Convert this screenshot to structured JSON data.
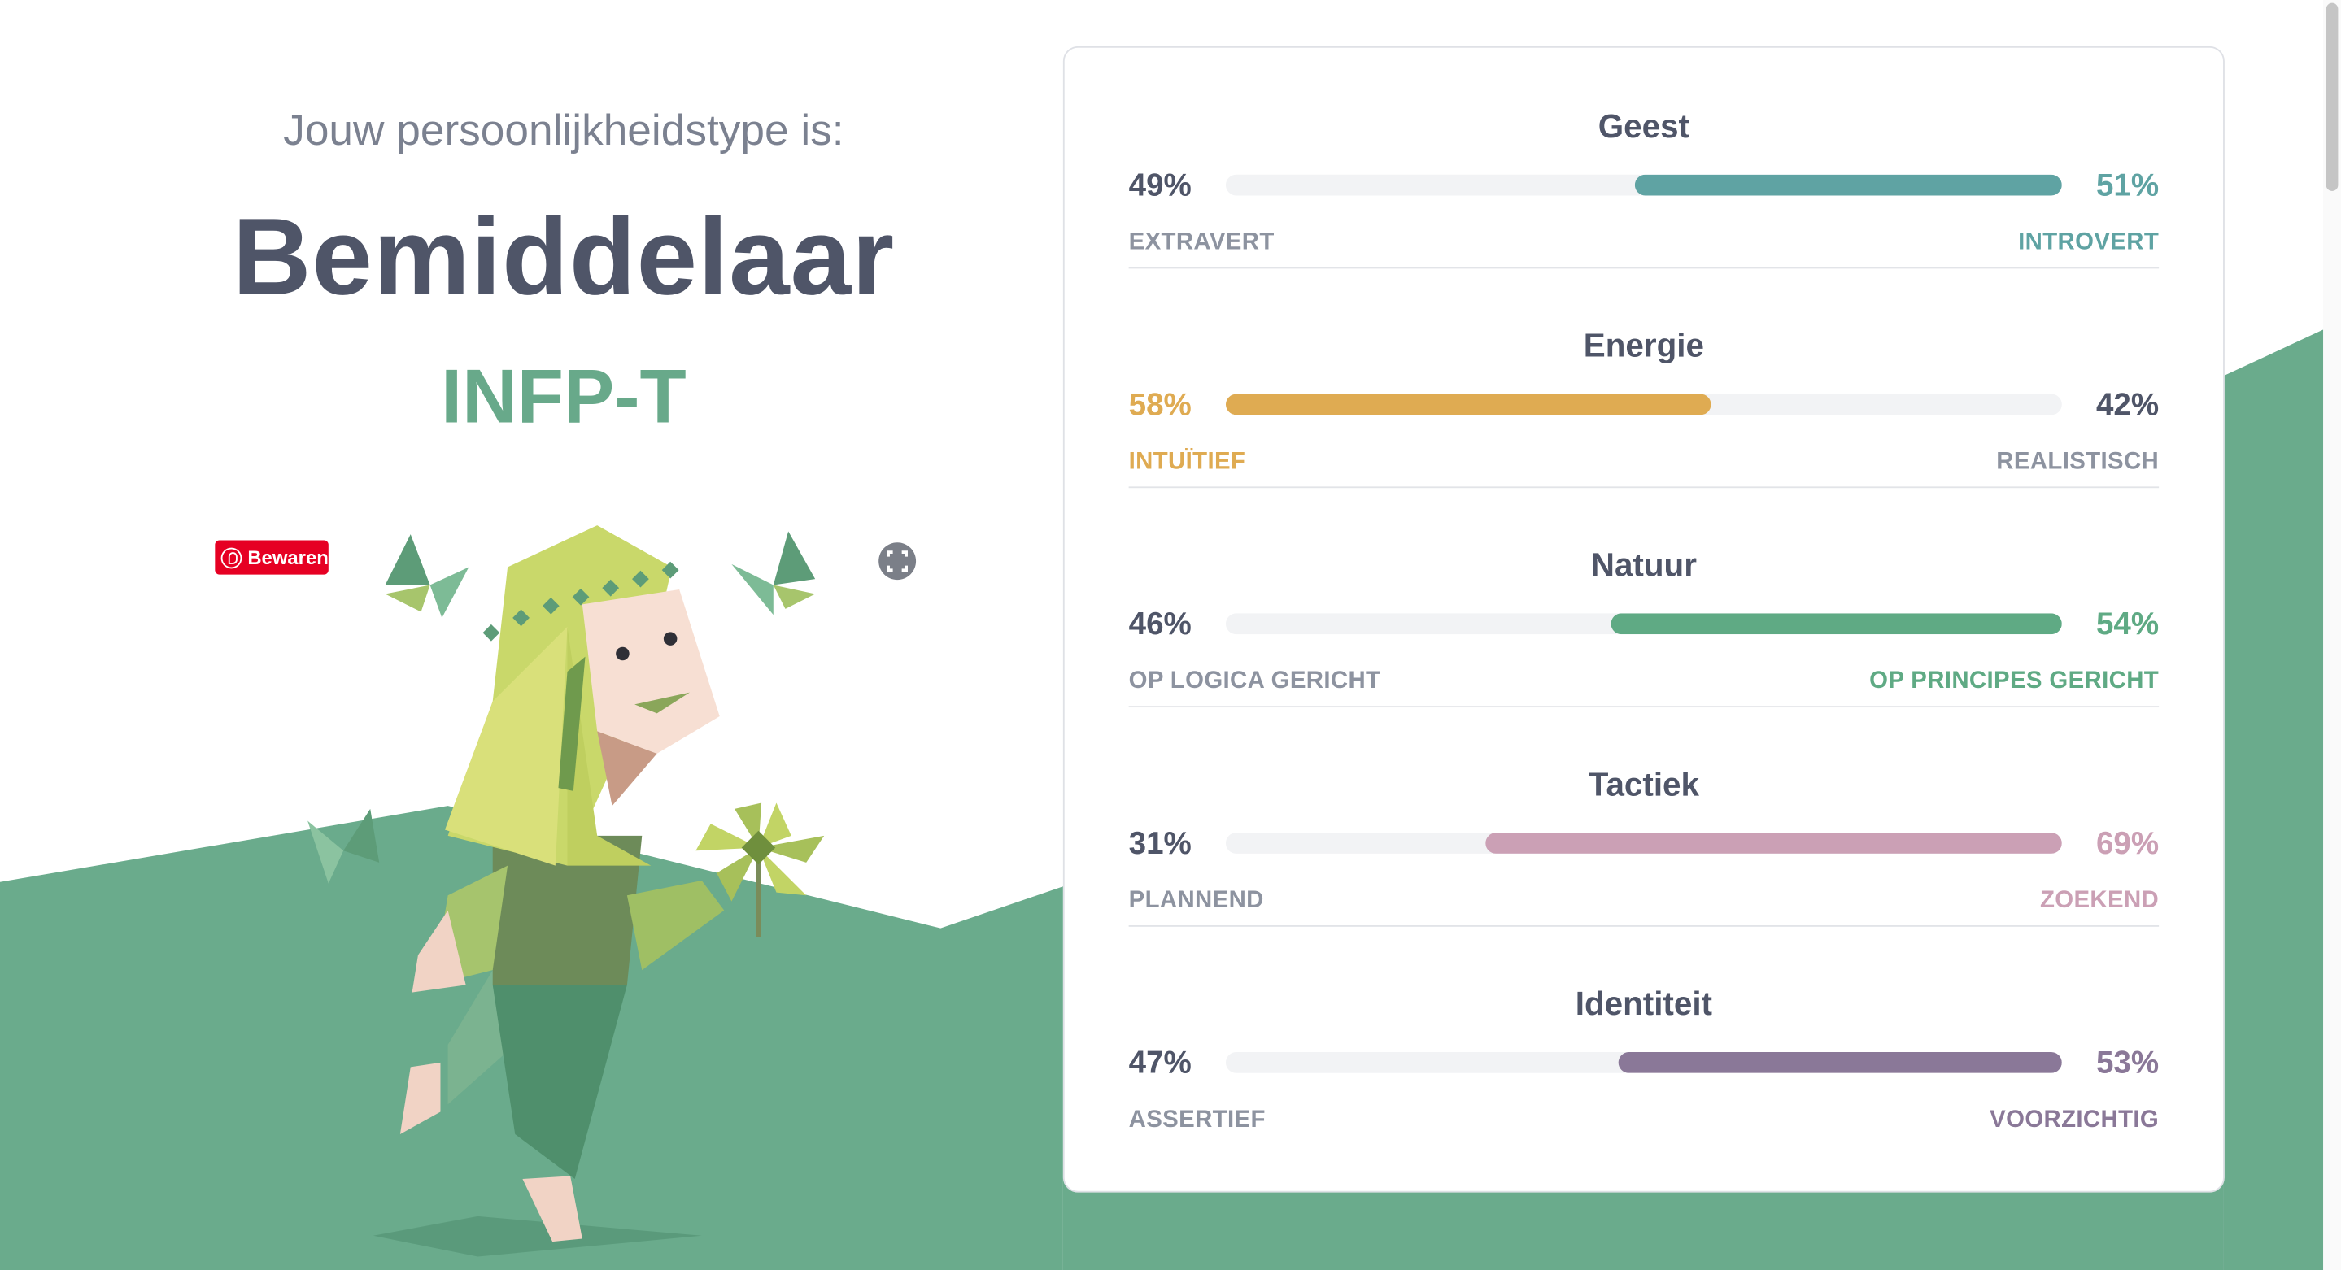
{
  "intro": {
    "label": "Jouw persoonlijkheidstype is:",
    "type_name": "Bemiddelaar",
    "type_code": "INFP-T"
  },
  "pin_button": {
    "label": "Bewaren",
    "color": "#e60023"
  },
  "icons": {
    "pin": "pinterest-icon",
    "expand": "expand-icon"
  },
  "colors": {
    "terrain": "#6aab8c",
    "heading": "#4f5568",
    "type_code": "#68a98a",
    "neutral_text": "#8d93a0"
  },
  "traits": [
    {
      "title": "Geest",
      "left_pct": "49%",
      "right_pct": "51%",
      "left_label": "EXTRAVERT",
      "right_label": "INTROVERT",
      "dominant": "right",
      "value": 51,
      "color": "#5fa3a3"
    },
    {
      "title": "Energie",
      "left_pct": "58%",
      "right_pct": "42%",
      "left_label": "INTUÏTIEF",
      "right_label": "REALISTISCH",
      "dominant": "left",
      "value": 58,
      "color": "#dfab52"
    },
    {
      "title": "Natuur",
      "left_pct": "46%",
      "right_pct": "54%",
      "left_label": "OP LOGICA GERICHT",
      "right_label": "OP PRINCIPES GERICHT",
      "dominant": "right",
      "value": 54,
      "color": "#5faa84"
    },
    {
      "title": "Tactiek",
      "left_pct": "31%",
      "right_pct": "69%",
      "left_label": "PLANNEND",
      "right_label": "ZOEKEND",
      "dominant": "right",
      "value": 69,
      "color": "#cba0b5"
    },
    {
      "title": "Identiteit",
      "left_pct": "47%",
      "right_pct": "53%",
      "left_label": "ASSERTIEF",
      "right_label": "VOORZICHTIG",
      "dominant": "right",
      "value": 53,
      "color": "#8a7898"
    }
  ]
}
